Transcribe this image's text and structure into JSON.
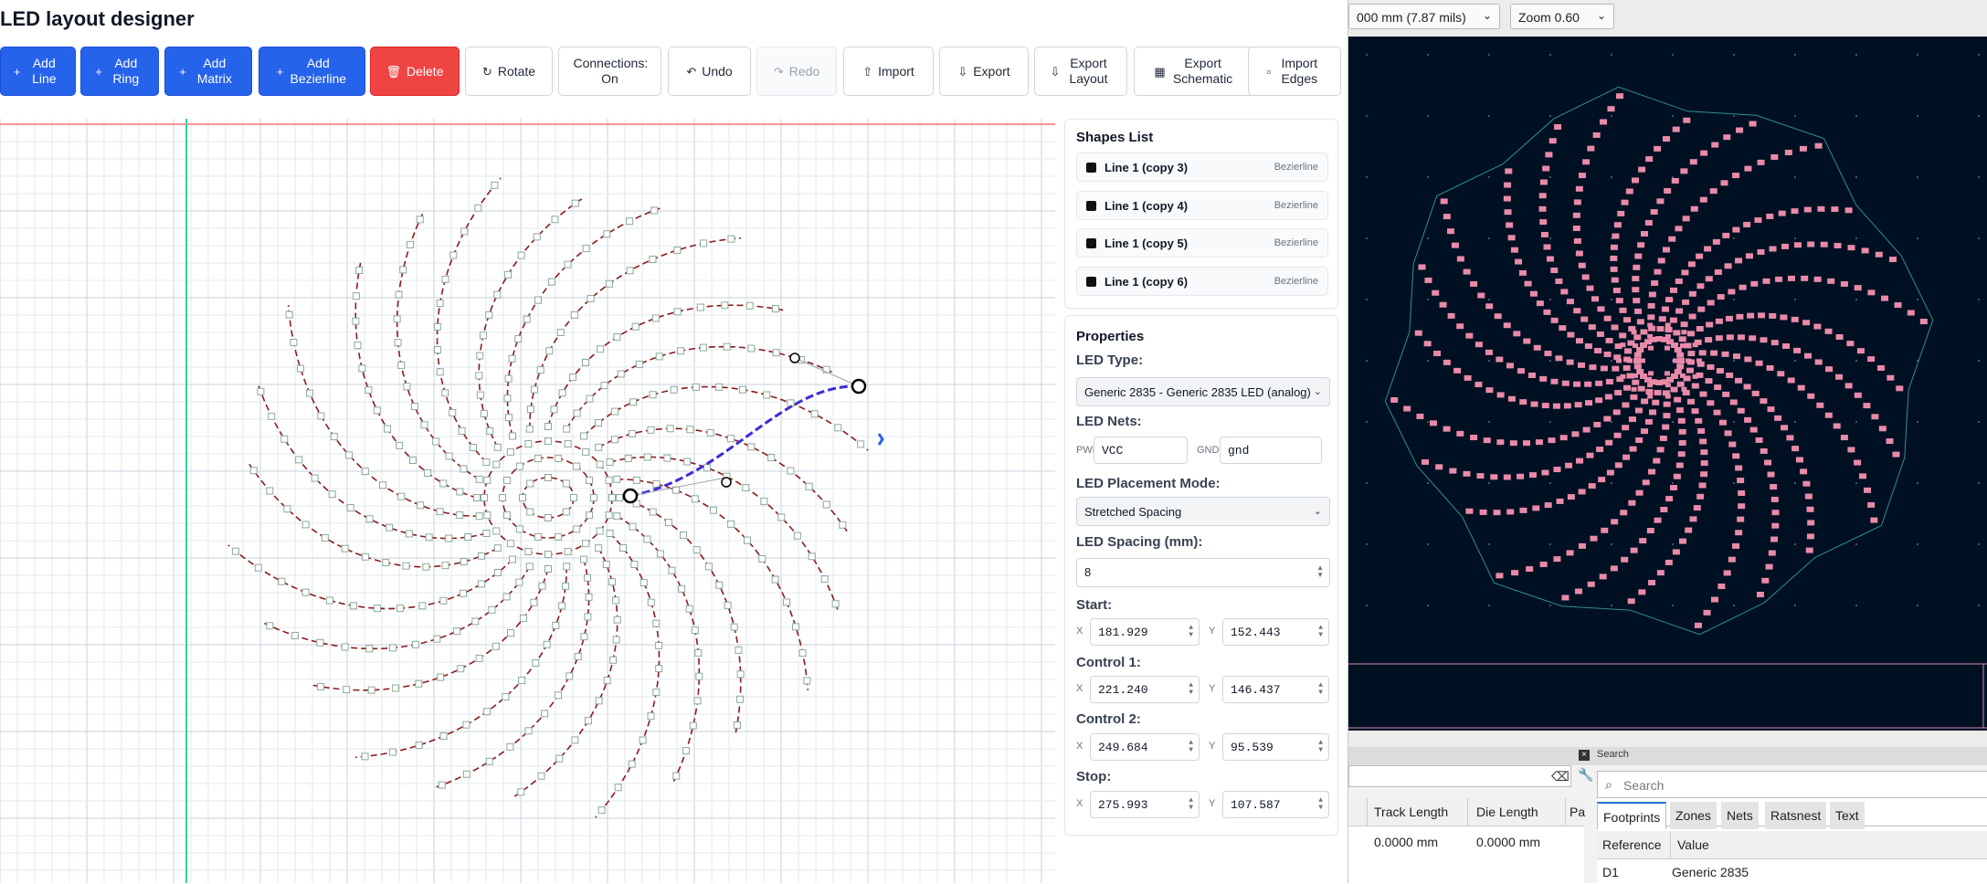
{
  "app": {
    "title": "LED layout designer",
    "toolbar": {
      "add_line": "Add Line",
      "add_ring": "Add Ring",
      "add_matrix": "Add Matrix",
      "add_bezierline": "Add Bezierline",
      "delete": "Delete",
      "rotate": "Rotate",
      "connections": "Connections: On",
      "undo": "Undo",
      "redo": "Redo",
      "import": "Import",
      "export": "Export",
      "export_layout": "Export Layout",
      "export_schematic": "Export Schematic",
      "import_edges": "Import Edges"
    },
    "shapes_list": {
      "title": "Shapes List",
      "items": [
        {
          "name": "Line 1 (copy 3)",
          "type": "Bezierline"
        },
        {
          "name": "Line 1 (copy 4)",
          "type": "Bezierline"
        },
        {
          "name": "Line 1 (copy 5)",
          "type": "Bezierline"
        },
        {
          "name": "Line 1 (copy 6)",
          "type": "Bezierline"
        }
      ]
    },
    "properties": {
      "title": "Properties",
      "led_type_label": "LED Type:",
      "led_type_value": "Generic 2835 - Generic 2835 LED (analog)",
      "led_nets_label": "LED Nets:",
      "pwr_label": "PWR",
      "pwr_value": "VCC",
      "gnd_label": "GND",
      "gnd_value": "gnd",
      "placement_label": "LED Placement Mode:",
      "placement_value": "Stretched Spacing",
      "spacing_label": "LED Spacing (mm):",
      "spacing_value": "8",
      "start_label": "Start:",
      "start_x": "181.929",
      "start_y": "152.443",
      "control1_label": "Control 1:",
      "control1_x": "221.240",
      "control1_y": "146.437",
      "control2_label": "Control 2:",
      "control2_x": "249.684",
      "control2_y": "95.539",
      "stop_label": "Stop:",
      "stop_x": "275.993",
      "stop_y": "107.587",
      "x_label": "X",
      "y_label": "Y"
    }
  },
  "pcb": {
    "grid_combo": "000 mm (7.87 mils)",
    "zoom_combo": "Zoom 0.60",
    "search_title": "Search",
    "search_placeholder": "Search",
    "tabs": [
      "Footprints",
      "Zones",
      "Nets",
      "Ratsnest",
      "Text"
    ],
    "col_reference": "Reference",
    "col_value": "Value",
    "row_ref": "D1",
    "row_value": "Generic 2835",
    "col_track_length": "Track Length",
    "col_die_length": "Die Length",
    "col_pa": "Pa",
    "track_length_value": "0.0000 mm",
    "die_length_value": "0.0000 mm"
  },
  "colors": {
    "primary": "#2563eb",
    "danger": "#ef4444",
    "led_trace": "#8b1a1a",
    "selected_curve": "#3b2bd6",
    "pcb_bg": "#001023",
    "pcb_pad": "#e98aa8",
    "pcb_ratsnest": "#2f8f8f"
  }
}
